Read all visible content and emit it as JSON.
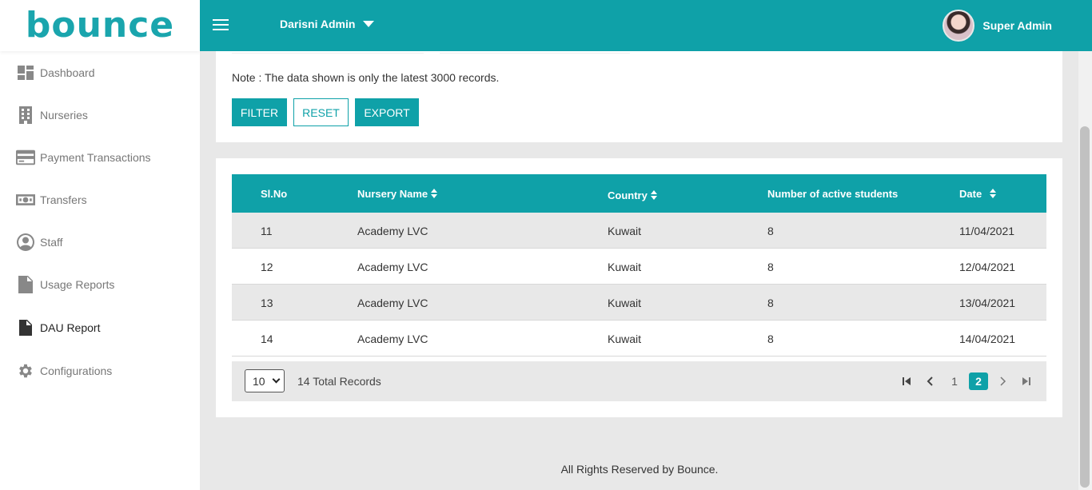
{
  "brand": {
    "logo_text": "bounce",
    "accent": "#0fa1a8",
    "logo_dot": "#8cc63f"
  },
  "sidebar": {
    "items": [
      {
        "label": "Dashboard",
        "icon": "dashboard-icon"
      },
      {
        "label": "Nurseries",
        "icon": "building-icon"
      },
      {
        "label": "Payment Transactions",
        "icon": "credit-card-icon"
      },
      {
        "label": "Transfers",
        "icon": "money-icon"
      },
      {
        "label": "Staff",
        "icon": "user-circle-icon"
      },
      {
        "label": "Usage Reports",
        "icon": "document-icon"
      },
      {
        "label": "DAU Report",
        "icon": "document-icon",
        "active": true
      },
      {
        "label": "Configurations",
        "icon": "gear-icon"
      }
    ]
  },
  "header": {
    "admin_selector": "Darisni Admin",
    "user_name": "Super Admin"
  },
  "filters": {
    "note": "Note : The data shown is only the latest 3000 records.",
    "filter_label": "FILTER",
    "reset_label": "RESET",
    "export_label": "EXPORT"
  },
  "table": {
    "columns": [
      "Sl.No",
      "Nursery Name",
      "Country",
      "Number of active students",
      "Date"
    ],
    "rows": [
      [
        "11",
        "Academy LVC",
        "Kuwait",
        "8",
        "11/04/2021"
      ],
      [
        "12",
        "Academy LVC",
        "Kuwait",
        "8",
        "12/04/2021"
      ],
      [
        "13",
        "Academy LVC",
        "Kuwait",
        "8",
        "13/04/2021"
      ],
      [
        "14",
        "Academy LVC",
        "Kuwait",
        "8",
        "14/04/2021"
      ]
    ]
  },
  "pagination": {
    "page_size": "10",
    "total_text": "14 Total Records",
    "pages": [
      "1",
      "2"
    ],
    "current_page": "2"
  },
  "footer": {
    "copyright": "All Rights Reserved by Bounce."
  }
}
